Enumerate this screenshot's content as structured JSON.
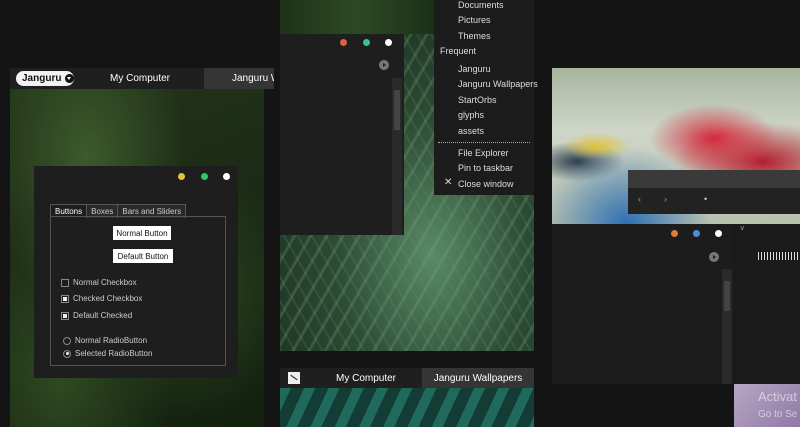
{
  "left_window": {
    "taskbar": {
      "pill_label": "Janguru",
      "tab_my_computer": "My Computer",
      "tab_wallpapers": "Janguru Wall"
    },
    "dialog": {
      "tabs": [
        "Buttons",
        "Boxes",
        "Bars and Sliders"
      ],
      "normal_button": "Normal Button",
      "default_button": "Default Button",
      "normal_checkbox": "Normal Checkbox",
      "checked_checkbox": "Checked Checkbox",
      "default_checked": "Default Checked",
      "normal_radio": "Normal RadioButton",
      "selected_radio": "Selected RadioButton",
      "dot_colors": [
        "#e8c23a",
        "#35c46a",
        "#ffffff"
      ]
    }
  },
  "middle_window": {
    "dot_colors": [
      "#e0633a",
      "#35c49a",
      "#ffffff"
    ]
  },
  "jump_list": {
    "pinned": [
      "Documents",
      "Pictures",
      "Themes"
    ],
    "frequent_heading": "Frequent",
    "frequent": [
      "Janguru",
      "Janguru Wallpapers",
      "StartOrbs",
      "glyphs",
      "assets"
    ],
    "actions": [
      "File Explorer",
      "Pin to taskbar",
      "Close window"
    ]
  },
  "bottom_taskbar": {
    "tab_my_computer": "My Computer",
    "tab_wallpapers": "Janguru Wallpapers"
  },
  "right_window": {
    "nav_back": "‹",
    "nav_forward": "›",
    "nav_dot": "•",
    "dot_colors": [
      "#e07a3a",
      "#4a8fd8",
      "#ffffff"
    ],
    "chevron": "˅"
  },
  "watermark": {
    "line1": "Activat",
    "line2": "Go to Se"
  }
}
